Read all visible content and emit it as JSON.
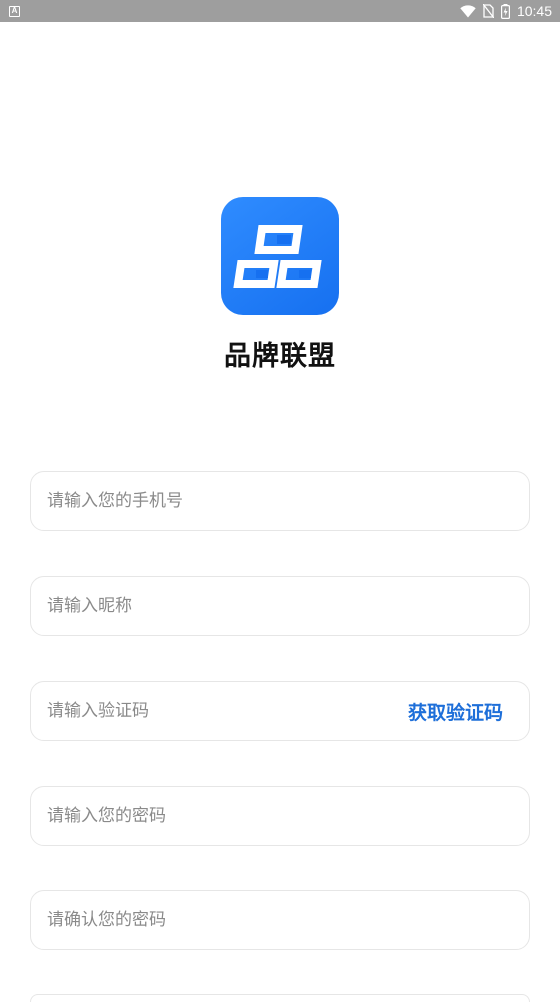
{
  "status_bar": {
    "notification_icon": "A",
    "icons": [
      "wifi-icon",
      "no-sim-icon",
      "battery-icon"
    ],
    "time": "10:45"
  },
  "app": {
    "logo_icon": "brand-logo-icon",
    "name": "品牌联盟",
    "brand_color": "#1e78f5"
  },
  "form": {
    "phone_placeholder": "请输入您的手机号",
    "nickname_placeholder": "请输入昵称",
    "code_placeholder": "请输入验证码",
    "get_code_label": "获取验证码",
    "password_placeholder": "请输入您的密码",
    "confirm_password_placeholder": "请确认您的密码"
  },
  "colors": {
    "accent": "#1e6fd9",
    "field_border": "#e6e6e6",
    "placeholder": "#8a8a8a",
    "status_bar": "#9e9e9e"
  }
}
